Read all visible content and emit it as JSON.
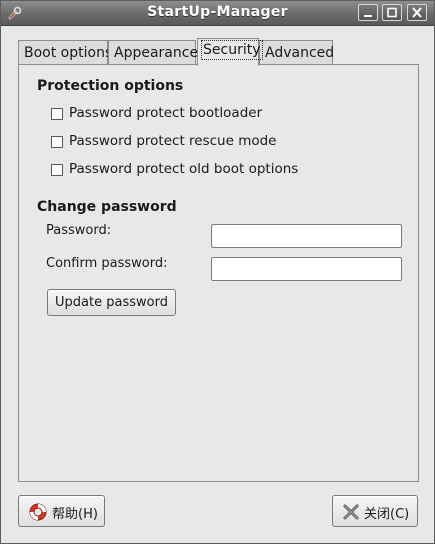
{
  "window": {
    "title": "StartUp-Manager",
    "controls": [
      "minimize-icon",
      "maximize-icon",
      "close-icon"
    ]
  },
  "tabs": [
    {
      "label": "Boot options",
      "active": false
    },
    {
      "label": "Appearance",
      "active": false
    },
    {
      "label": "Security",
      "active": true
    },
    {
      "label": "Advanced",
      "active": false
    }
  ],
  "protection": {
    "title": "Protection options",
    "options": [
      {
        "label": "Password protect bootloader",
        "checked": false
      },
      {
        "label": "Password protect rescue mode",
        "checked": false
      },
      {
        "label": "Password protect old boot options",
        "checked": false
      }
    ]
  },
  "change_password": {
    "title": "Change password",
    "password_label": "Password:",
    "password_value": "",
    "confirm_label": "Confirm password:",
    "confirm_value": "",
    "update_button": "Update password"
  },
  "footer": {
    "help_button": "帮助(H)",
    "help_icon": "lifebuoy-icon",
    "close_button": "关闭(C)",
    "close_icon": "close-x-icon"
  },
  "colors": {
    "titlebar": "#6a6a6a",
    "background": "#e8e8e8",
    "help_icon_red": "#d9362b"
  }
}
